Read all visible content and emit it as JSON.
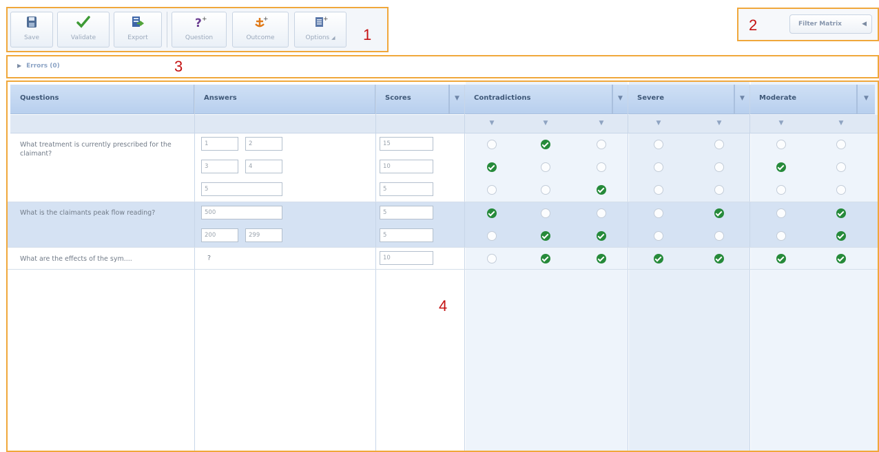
{
  "toolbar": {
    "save": "Save",
    "validate": "Validate",
    "export": "Export",
    "question": "Question",
    "outcome": "Outcome",
    "options": "Options"
  },
  "filter": {
    "label": "Filter Matrix"
  },
  "errors": {
    "label": "Errors (0)"
  },
  "callouts": [
    "1",
    "2",
    "3",
    "4"
  ],
  "matrix": {
    "headers": {
      "questions": "Questions",
      "answers": "Answers",
      "scores": "Scores",
      "contradictions": "Contradictions",
      "severe": "Severe",
      "moderate": "Moderate"
    },
    "rows": [
      {
        "question": "What treatment is currently prescribed for the claimant?",
        "answers": [
          [
            "1",
            "2"
          ],
          [
            "3",
            "4"
          ],
          [
            "5"
          ]
        ],
        "scores": [
          "15",
          "10",
          "5"
        ],
        "checks": [
          [
            0,
            1,
            0,
            0,
            0,
            0,
            0
          ],
          [
            1,
            0,
            0,
            0,
            0,
            1,
            0
          ],
          [
            0,
            0,
            1,
            0,
            0,
            0,
            0
          ]
        ]
      },
      {
        "question": "What is the claimants peak flow reading?",
        "answers": [
          [
            "500"
          ],
          [
            "200",
            "299"
          ]
        ],
        "scores": [
          "5",
          "5"
        ],
        "checks": [
          [
            1,
            0,
            0,
            0,
            1,
            0,
            1
          ],
          [
            0,
            1,
            1,
            0,
            0,
            0,
            1
          ]
        ]
      },
      {
        "question": "What are the effects of the sym....",
        "answers": [
          [
            "?"
          ]
        ],
        "scores": [
          "10"
        ],
        "checks": [
          [
            0,
            1,
            1,
            1,
            1,
            1,
            1
          ]
        ]
      }
    ]
  },
  "colors": {
    "accent": "#f0a73a",
    "check": "#268a3a",
    "callout": "#c41212"
  }
}
